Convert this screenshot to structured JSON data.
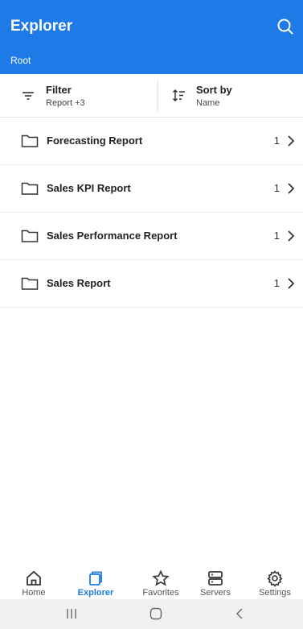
{
  "appbar": {
    "title": "Explorer",
    "breadcrumb": "Root",
    "accent": "#1e7ae6"
  },
  "filter": {
    "label": "Filter",
    "value": "Report +3"
  },
  "sort": {
    "label": "Sort by",
    "value": "Name"
  },
  "items": [
    {
      "name": "Forecasting Report",
      "count": "1"
    },
    {
      "name": "Sales KPI Report",
      "count": "1"
    },
    {
      "name": "Sales Performance Report",
      "count": "1"
    },
    {
      "name": "Sales Report",
      "count": "1"
    }
  ],
  "nav": [
    {
      "label": "Home",
      "icon": "home-icon"
    },
    {
      "label": "Explorer",
      "icon": "explorer-icon",
      "active": true
    },
    {
      "label": "Favorites",
      "icon": "star-icon"
    },
    {
      "label": "Servers",
      "icon": "servers-icon"
    },
    {
      "label": "Settings",
      "icon": "gear-icon"
    }
  ]
}
